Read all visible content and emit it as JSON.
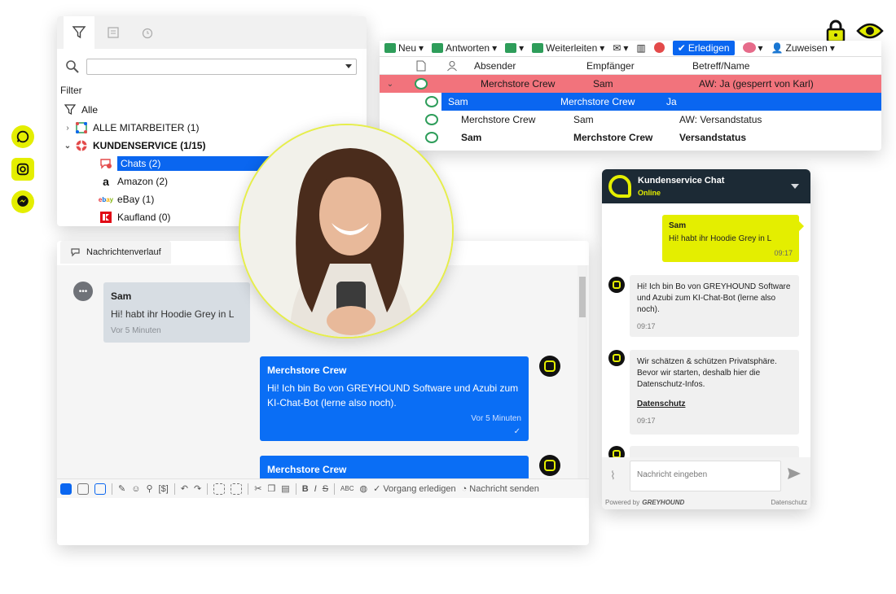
{
  "folder_panel": {
    "filter_label": "Filter",
    "tree": [
      {
        "label": "Alle",
        "expander": ""
      },
      {
        "label": "ALLE MITARBEITER (1)",
        "expander": "›"
      },
      {
        "label": "KUNDENSERVICE (1/15)",
        "expander": "⌄"
      },
      {
        "label": "Chats (2)",
        "expander": ""
      },
      {
        "label": "Amazon (2)",
        "expander": ""
      },
      {
        "label": "eBay (1)",
        "expander": ""
      },
      {
        "label": "Kaufland (0)",
        "expander": ""
      }
    ]
  },
  "mail_panel": {
    "toolbar": {
      "new": "Neu",
      "reply": "Antworten",
      "forward": "Weiterleiten",
      "done": "Erledigen",
      "assign": "Zuweisen"
    },
    "columns": {
      "from": "Absender",
      "to": "Empfänger",
      "subject": "Betreff/Name"
    },
    "rows": [
      {
        "from": "Merchstore Crew",
        "to": "Sam",
        "subject": "AW: Ja (gesperrt von Karl)"
      },
      {
        "from": "Sam",
        "to": "Merchstore Crew",
        "subject": "Ja"
      },
      {
        "from": "Merchstore Crew",
        "to": "Sam",
        "subject": "AW: Versandstatus"
      },
      {
        "from": "Sam",
        "to": "Merchstore Crew",
        "subject": "Versandstatus"
      }
    ]
  },
  "conversation": {
    "tab_label": "Nachrichtenverlauf",
    "incoming": {
      "name": "Sam",
      "text": "Hi! habt ihr Hoodie Grey in L",
      "time": "Vor 5 Minuten"
    },
    "outgoing": [
      {
        "name": "Merchstore Crew",
        "text": "Hi! Ich bin Bo von GREYHOUND Software und Azubi zum KI-Chat-Bot (lerne also noch).",
        "time": "Vor 5 Minuten"
      },
      {
        "name": "Merchstore Crew",
        "text": "",
        "time": ""
      }
    ],
    "toolbar": {
      "complete": "Vorgang erledigen",
      "send": "Nachricht senden"
    }
  },
  "widget": {
    "title": "Kundenservice Chat",
    "status": "Online",
    "user_msg": {
      "name": "Sam",
      "text": "Hi! habt ihr Hoodie Grey in L",
      "time": "09:17"
    },
    "bot_msgs": [
      {
        "text": "Hi! Ich bin Bo von GREYHOUND Software und Azubi zum KI-Chat-Bot (lerne also noch).",
        "time": "09:17"
      },
      {
        "text": "Wir schätzen & schützen Privatsphäre. Bevor wir starten, deshalb hier die Datenschutz-Infos.",
        "link": "Datenschutz",
        "time": "09:17"
      }
    ],
    "input_placeholder": "Nachricht eingeben",
    "powered_by": "Powered by",
    "brand": "GREYHOUND",
    "privacy": "Datenschutz"
  },
  "colors": {
    "accent_yellow": "#e4ee00",
    "selection_blue": "#0a66f0",
    "locked_red": "#f2737c"
  }
}
